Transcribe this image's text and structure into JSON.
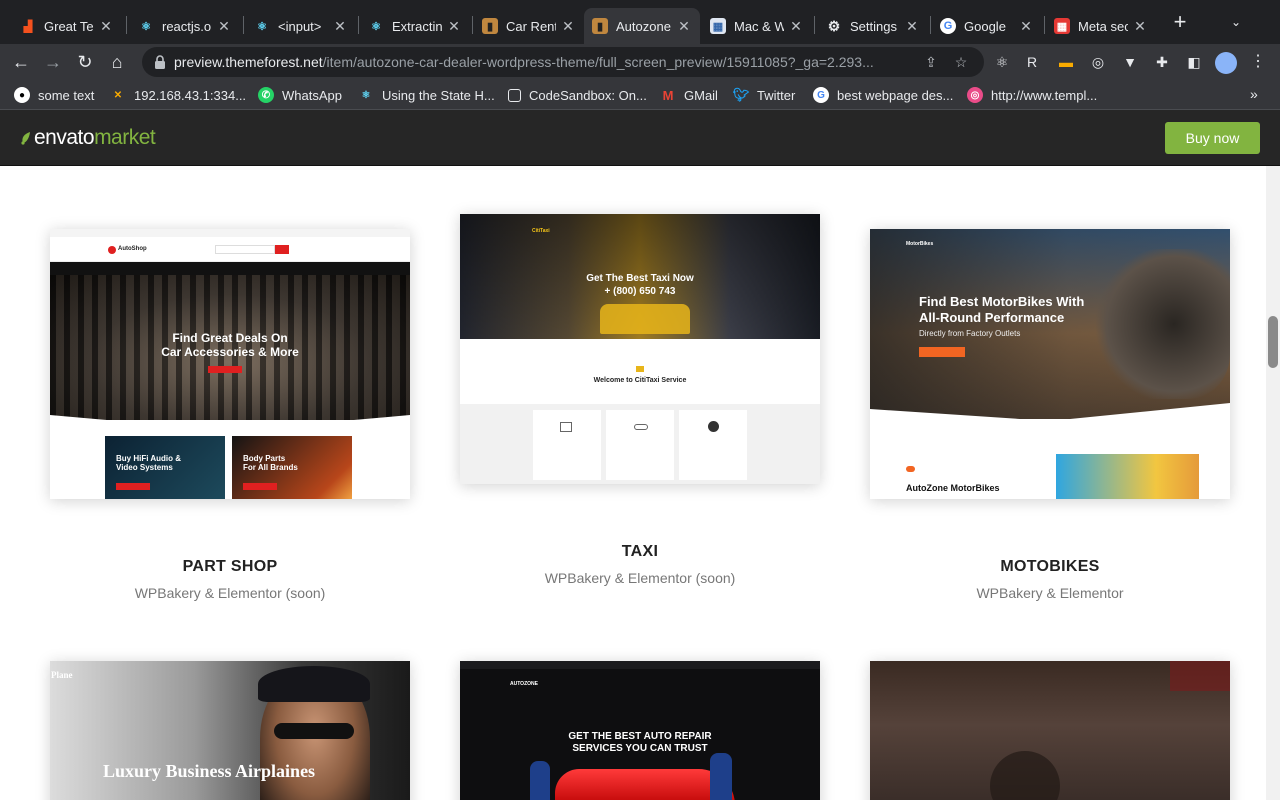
{
  "browser": {
    "tabs": [
      {
        "title": "Great Te",
        "icon": "chart-icon",
        "color": "#f4511e"
      },
      {
        "title": "reactjs.o",
        "icon": "react-icon",
        "color": "#61dafb"
      },
      {
        "title": "<input>",
        "icon": "react-icon",
        "color": "#61dafb"
      },
      {
        "title": "Extractin",
        "icon": "react-icon",
        "color": "#61dafb"
      },
      {
        "title": "Car Rent",
        "icon": "themeforest-icon",
        "color": "#c0873f"
      },
      {
        "title": "Autozone",
        "icon": "themeforest-icon",
        "color": "#c0873f"
      },
      {
        "title": "Mac & W",
        "icon": "page-icon",
        "color": "#8ab4f8"
      },
      {
        "title": "Settings",
        "icon": "gear-icon",
        "color": "#e8eaed"
      },
      {
        "title": "Google",
        "icon": "google-icon",
        "color": "#4285f4"
      },
      {
        "title": "Meta sec",
        "icon": "grid-icon",
        "color": "#e53935"
      }
    ],
    "url_host": "preview.themeforest.net",
    "url_path": "/item/autozone-car-dealer-wordpress-theme/full_screen_preview/15911085?_ga=2.293...",
    "bookmarks": [
      {
        "label": "some text",
        "icon": "github-icon"
      },
      {
        "label": "192.168.43.1:334...",
        "icon": "x-icon"
      },
      {
        "label": "WhatsApp",
        "icon": "whatsapp-icon"
      },
      {
        "label": "Using the State H...",
        "icon": "react-icon"
      },
      {
        "label": "CodeSandbox: On...",
        "icon": "codesandbox-icon"
      },
      {
        "label": "GMail",
        "icon": "gmail-icon"
      },
      {
        "label": "Twitter",
        "icon": "twitter-icon"
      },
      {
        "label": "best webpage des...",
        "icon": "google-icon"
      },
      {
        "label": "http://www.templ...",
        "icon": "dribbble-icon"
      }
    ]
  },
  "header": {
    "logo_part1": "envato",
    "logo_part2": "market",
    "buy_label": "Buy now"
  },
  "cards": [
    {
      "title": "PART SHOP",
      "subtitle": "WPBakery & Elementor (soon)",
      "preview": {
        "brand": "AutoShop",
        "headline1": "Find Great Deals On",
        "headline2": "Car Accessories & More",
        "promo1a": "Buy HiFi Audio &",
        "promo1b": "Video Systems",
        "promo2a": "Body Parts",
        "promo2b": "For All Brands"
      }
    },
    {
      "title": "TAXI",
      "subtitle": "WPBakery & Elementor (soon)",
      "preview": {
        "brand": "CitiTaxi",
        "headline1": "Get The Best Taxi Now",
        "headline2": "+ (800) 650 743",
        "welcome": "Welcome to CitiTaxi Service"
      }
    },
    {
      "title": "MOTOBIKES",
      "subtitle": "WPBakery & Elementor",
      "preview": {
        "brand": "MotorBikes",
        "headline1": "Find Best MotorBikes With",
        "headline2": "All-Round Performance",
        "headline3": "Directly from Factory Outlets",
        "section": "AutoZone MotorBikes"
      }
    }
  ],
  "row2": [
    {
      "brand": "Plane",
      "headline": "Luxury Business Airplaines"
    },
    {
      "brand": "AUTOZONE",
      "headline1": "GET THE BEST AUTO REPAIR",
      "headline2": "SERVICES YOU CAN TRUST"
    },
    {
      "brand": ""
    }
  ]
}
